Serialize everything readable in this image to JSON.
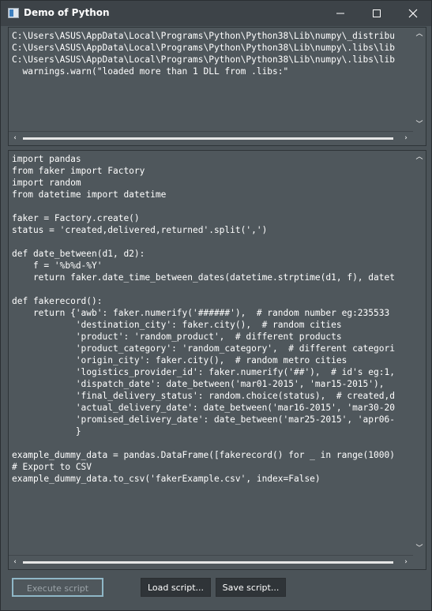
{
  "window": {
    "title": "Demo of Python",
    "controls": {
      "minimize": "—",
      "maximize": "☐",
      "close": "✕"
    }
  },
  "output_console": {
    "text": "C:\\Users\\ASUS\\AppData\\Local\\Programs\\Python\\Python38\\Lib\\numpy\\_distribu\nC:\\Users\\ASUS\\AppData\\Local\\Programs\\Python\\Python38\\Lib\\numpy\\.libs\\lib\nC:\\Users\\ASUS\\AppData\\Local\\Programs\\Python\\Python38\\Lib\\numpy\\.libs\\lib\n  warnings.warn(\"loaded more than 1 DLL from .libs:\""
  },
  "code_editor": {
    "text": "import pandas\nfrom faker import Factory\nimport random\nfrom datetime import datetime\n\nfaker = Factory.create()\nstatus = 'created,delivered,returned'.split(',')\n\ndef date_between(d1, d2):\n    f = '%b%d-%Y'\n    return faker.date_time_between_dates(datetime.strptime(d1, f), datet\n\ndef fakerecord():\n    return {'awb': faker.numerify('######'),  # random number eg:235533\n            'destination_city': faker.city(),  # random cities\n            'product': 'random_product',  # different products\n            'product_category': 'random_category',  # different categori\n            'origin_city': faker.city(),  # random metro cities\n            'logistics_provider_id': faker.numerify('##'),  # id's eg:1,\n            'dispatch_date': date_between('mar01-2015', 'mar15-2015'),\n            'final_delivery_status': random.choice(status),  # created,d\n            'actual_delivery_date': date_between('mar16-2015', 'mar30-20\n            'promised_delivery_date': date_between('mar25-2015', 'apr06-\n            }\n\nexample_dummy_data = pandas.DataFrame([fakerecord() for _ in range(1000)\n# Export to CSV\nexample_dummy_data.to_csv('fakerExample.csv', index=False)"
  },
  "buttons": {
    "execute": "Execute script",
    "load": "Load script...",
    "save": "Save script..."
  },
  "scrollbar_glyphs": {
    "up": "︿",
    "down": "﹀",
    "left": "‹",
    "right": "›"
  },
  "colors": {
    "window_bg": "#4b5358",
    "pane_bg": "#4f575c",
    "titlebar_bg": "#3d4348",
    "execute_border": "#8fb7c7"
  },
  "icons": [
    "python-app-icon",
    "minimize-icon",
    "maximize-icon",
    "close-icon",
    "scroll-up-icon",
    "scroll-down-icon",
    "scroll-left-icon",
    "scroll-right-icon"
  ]
}
